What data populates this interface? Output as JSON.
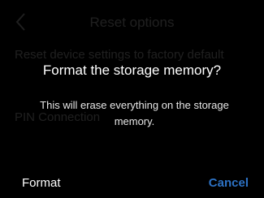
{
  "background_page": {
    "title": "Reset options",
    "back_icon": "chevron-left-icon",
    "row_reset_label": "Reset device settings to factory default",
    "row_pin_label": "PIN Connection"
  },
  "dialog": {
    "title": "Format the storage memory?",
    "message": "This will erase everything on the storage memory.",
    "format_label": "Format",
    "cancel_label": "Cancel"
  },
  "colors": {
    "background": "#000000",
    "text_primary": "#ffffff",
    "accent": "#2d72c4"
  }
}
